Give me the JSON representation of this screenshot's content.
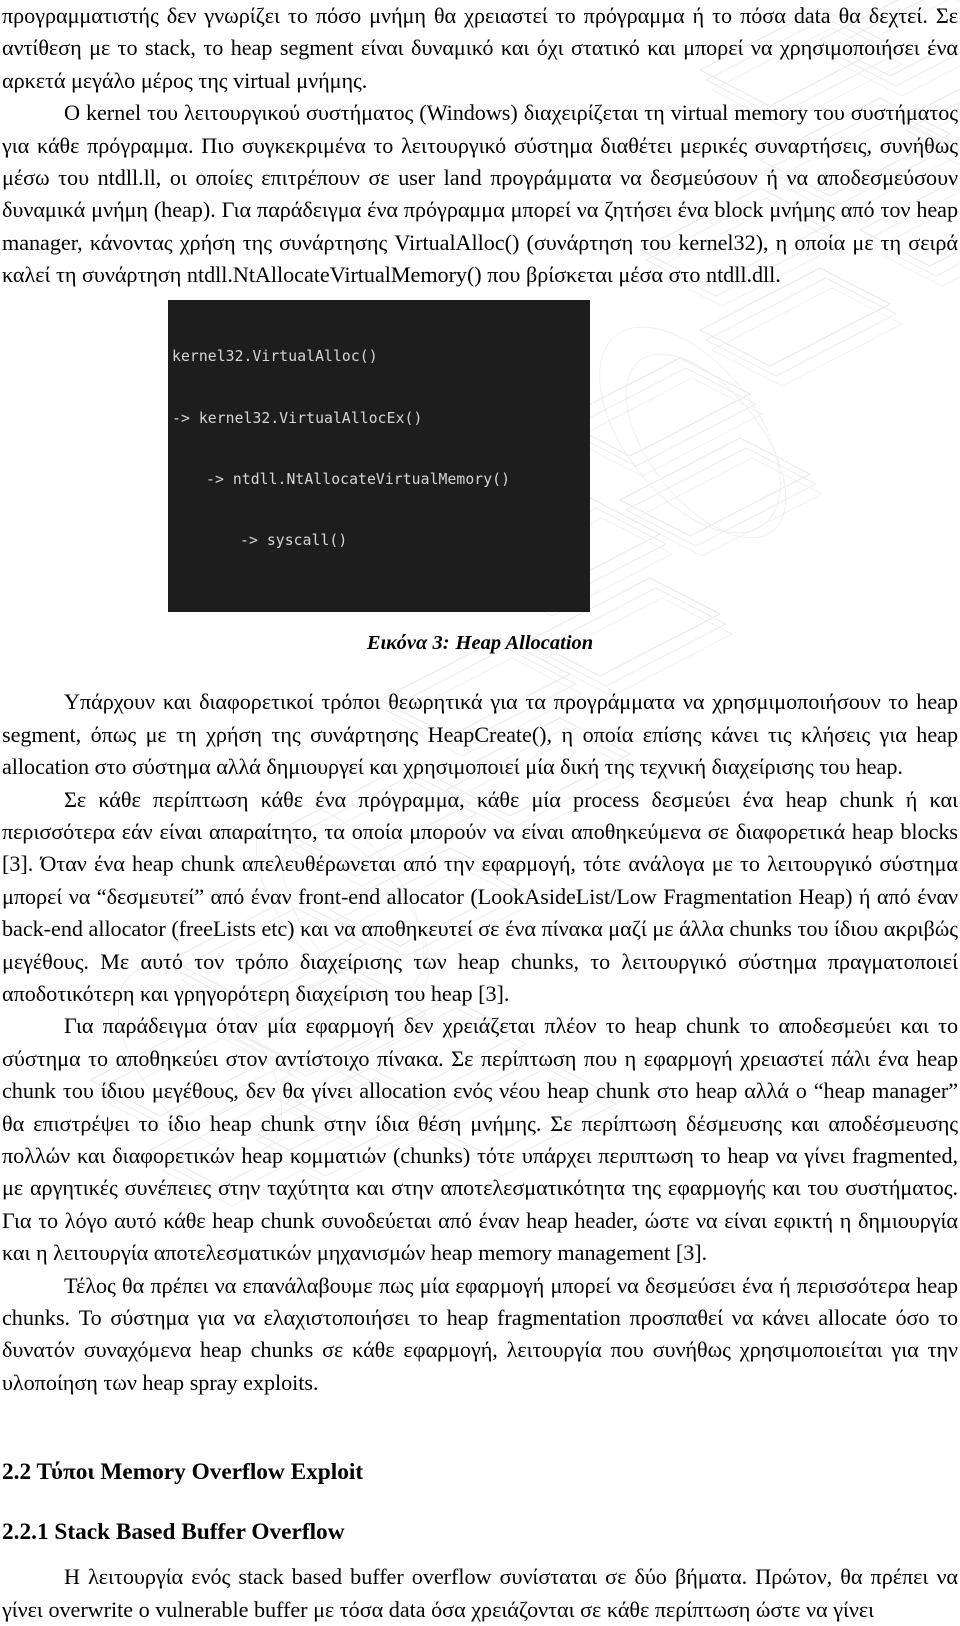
{
  "document": {
    "language": "el",
    "paragraphs": {
      "p1": "προγραμματιστής δεν γνωρίζει το πόσο μνήμη θα χρειαστεί το πρόγραμμα ή το πόσα data θα δεχτεί. Σε αντίθεση με το stack, το heap segment είναι δυναμικό και όχι στατικό και μπορεί να χρησιμοποιήσει ένα αρκετά μεγάλο μέρος της virtual μνήμης.",
      "p2": "Ο kernel του λειτουργικού συστήματος (Windows) διαχειρίζεται τη virtual memory του συστήματος για κάθε πρόγραμμα. Πιο συγκεκριμένα το λειτουργικό σύστημα διαθέτει μερικές συναρτήσεις, συνήθως μέσω του ntdll.ll, οι οποίες επιτρέπουν σε user land προγράμματα να δεσμεύσουν ή να αποδεσμεύσουν δυναμικά μνήμη (heap). Για παράδειγμα ένα πρόγραμμα μπορεί να ζητήσει ένα block μνήμης από τον heap manager, κάνοντας χρήση της συνάρτησης VirtualAlloc() (συνάρτηση του kernel32), η οποία με τη σειρά καλεί τη συνάρτηση ntdll.NtAllocateVirtualMemory() που βρίσκεται μέσα στο ntdll.dll.",
      "p3": "Υπάρχουν και διαφορετικοί τρόποι θεωρητικά για τα προγράμματα να χρησμιμοποιήσουν το heap segment, όπως με τη χρήση της συνάρτησης HeapCreate(), η οποία επίσης κάνει τις κλήσεις για heap allocation στο σύστημα αλλά δημιουργεί  και χρησιμοποιεί μία δική της τεχνική διαχείρισης του heap.",
      "p4": "Σε κάθε περίπτωση κάθε ένα πρόγραμμα, κάθε μία process δεσμεύει ένα heap chunk ή και περισσότερα εάν είναι απαραίτητο, τα οποία μπορούν να είναι αποθηκεύμενα σε διαφορετικά heap blocks [3]. Όταν ένα heap chunk απελευθέρωνεται από την εφαρμογή, τότε ανάλογα με το λειτουργικό σύστημα μπορεί να “δεσμευτεί” από έναν front-end allocator  (LookAsideList/Low Fragmentation Heap) ή από έναν back-end allocator (freeLists etc) και να αποθηκευτεί σε ένα πίνακα μαζί με άλλα chunks του ίδιου ακριβώς μεγέθους. Με αυτό τον τρόπο διαχείρισης των heap chunks, το λειτουργικό σύστημα πραγματοποιεί αποδοτικότερη και γρηγορότερη διαχείριση του heap [3].",
      "p5": "Για παράδειγμα όταν μία εφαρμογή δεν χρειάζεται πλέον το heap chunk το αποδεσμεύει και το σύστημα το αποθηκεύει στον αντίστοιχο πίνακα. Σε περίπτωση που η εφαρμογή χρειαστεί πάλι ένα heap chunk του ίδιου μεγέθους, δεν θα γίνει allocation ενός νέου heap chunk στο heap αλλά ο “heap manager” θα επιστρέψει το ίδιο heap chunk στην ίδια θέση μνήμης.  Σε περίπτωση δέσμευσης και αποδέσμευσης πολλών και διαφορετικών heap κομματιών (chunks) τότε υπάρχει περιπτωση το heap να γίνει fragmented, με αργητικές συνέπειες  στην ταχύτητα και στην αποτελεσματικότητα της εφαρμογής και του συστήματος.  Για το λόγο αυτό κάθε heap chunk συνοδεύεται από έναν heap header, ώστε να είναι εφικτή η δημιουργία και η λειτουργία αποτελεσματικών μηχανισμών heap memory management [3].",
      "p6": "Τέλος θα πρέπει να επανάλαβουμε πως μία εφαρμογή μπορεί να δεσμεύσει ένα ή περισσότερα heap chunks. Το σύστημα για να ελαχιστοποιήσει το heap fragmentation προσπαθεί να κάνει allocate όσο το δυνατόν συναχόμενα heap chunks σε κάθε εφαρμογή, λειτουργία που συνήθως χρησιμοποιείται για την υλοποίηση των heap spray exploits.",
      "p7": "Η λειτουργία ενός stack based buffer overflow συνίσταται σε δύο βήματα. Πρώτον, θα πρέπει να γίνει overwrite ο vulnerable buffer με τόσα data όσα χρειάζονται σε κάθε περίπτωση ώστε να γίνει"
    },
    "figure": {
      "caption_number": "Εικόνα 3:",
      "caption_title": "Heap Allocation",
      "code_lines": [
        "kernel32.VirtualAlloc()",
        "-> kernel32.VirtualAllocEx()",
        "-> ntdll.NtAllocateVirtualMemory()",
        "-> syscall()"
      ],
      "background_color": "#1d1d1d",
      "text_color": "#d6d6d6"
    },
    "headings": {
      "h_2_2": "2.2 Τύποι Memory Overflow Exploit",
      "h_2_2_1": "2.2.1 Stack Based Buffer Overflow"
    }
  }
}
